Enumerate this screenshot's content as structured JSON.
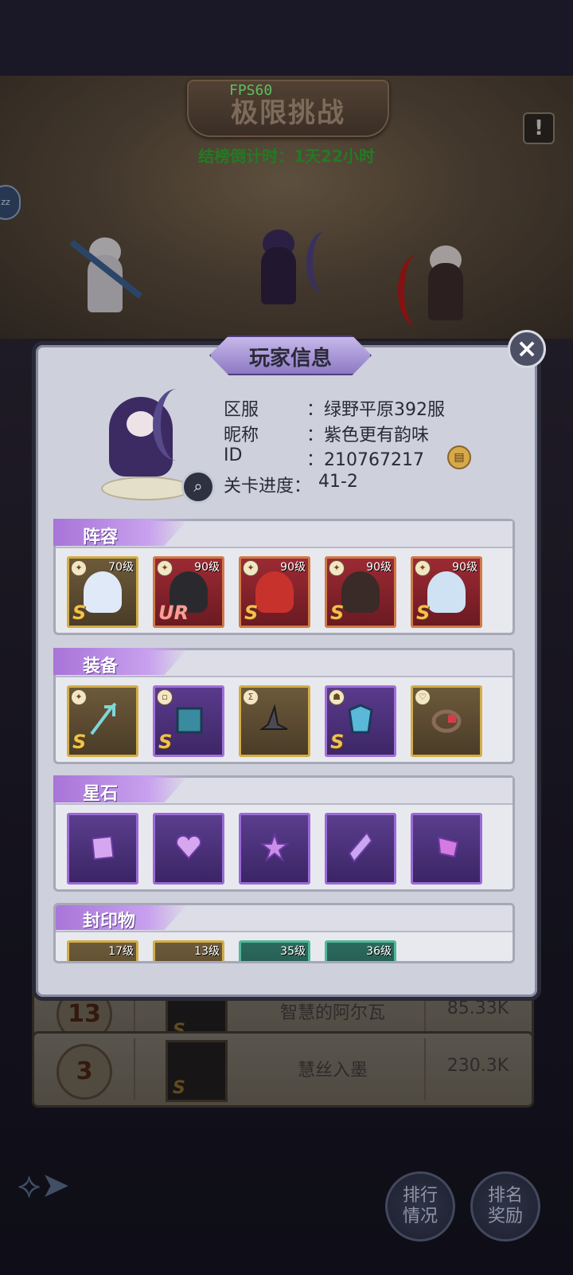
{
  "screen": {
    "title": "极限挑战",
    "fps": "FPS60",
    "countdown": "结榜倒计时：1天22小时",
    "warn_icon": "!",
    "side_badge": "zz"
  },
  "ranking": {
    "rows": [
      {
        "rank": "13",
        "name": "智慧的阿尔瓦",
        "score": "85.33K",
        "grade": "S"
      },
      {
        "rank": "3",
        "name": "慧丝入墨",
        "score": "230.3K",
        "grade": "S"
      }
    ]
  },
  "bottom_buttons": {
    "ranking": "排行\n情况",
    "ranking_line1": "排行",
    "ranking_line2": "情况",
    "reward_line1": "排名",
    "reward_line2": "奖励"
  },
  "modal": {
    "title": "玩家信息",
    "close_icon": "×",
    "info": [
      {
        "label": "区服",
        "value": "：绿野平原392服"
      },
      {
        "label": "昵称",
        "value": "：紫色更有韵味"
      },
      {
        "label": "ID",
        "value": "：210767217"
      },
      {
        "label": "关卡进度：",
        "value": "41-2"
      }
    ],
    "sections": {
      "lineup": {
        "title": "阵容",
        "heroes": [
          {
            "level": "70级",
            "grade": "S",
            "frame": "gold"
          },
          {
            "level": "90级",
            "grade": "UR",
            "frame": "red"
          },
          {
            "level": "90级",
            "grade": "S",
            "frame": "red"
          },
          {
            "level": "90级",
            "grade": "S",
            "frame": "red"
          },
          {
            "level": "90级",
            "grade": "S",
            "frame": "red"
          }
        ]
      },
      "equipment": {
        "title": "装备",
        "items": [
          {
            "name": "trident-icon",
            "grade": "S",
            "frame": "gold"
          },
          {
            "name": "spellbook-icon",
            "grade": "S",
            "frame": "purple"
          },
          {
            "name": "witch-hat-icon",
            "grade": "",
            "frame": "gold"
          },
          {
            "name": "armor-icon",
            "grade": "S",
            "frame": "purple"
          },
          {
            "name": "ring-icon",
            "grade": "",
            "frame": "gold"
          }
        ]
      },
      "starstones": {
        "title": "星石",
        "items": [
          "square-gem-icon",
          "heart-gem-icon",
          "star-gem-icon",
          "diamond-gem-icon",
          "drop-gem-icon"
        ]
      },
      "seals": {
        "title": "封印物",
        "items": [
          {
            "level": "17级",
            "frame": "gold"
          },
          {
            "level": "13级",
            "frame": "gold"
          },
          {
            "level": "35级",
            "frame": "teal"
          },
          {
            "level": "36级",
            "frame": "teal"
          }
        ]
      }
    }
  },
  "colors": {
    "panel": "#ced0dc",
    "accent_purple": "#a874d8",
    "fps_green": "#7dff7d",
    "countdown_green": "#2fa32f"
  }
}
